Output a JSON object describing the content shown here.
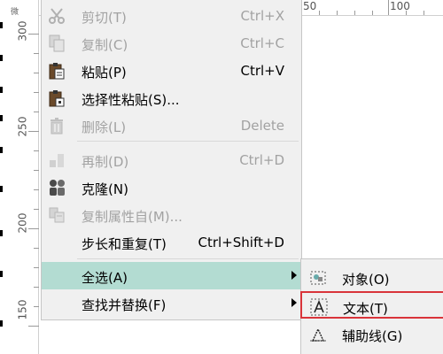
{
  "ruler": {
    "corner": "微",
    "vertical_labels": [
      "300",
      "250",
      "200",
      "150"
    ],
    "horizontal_labels": [
      "50",
      "100"
    ]
  },
  "menu": {
    "items": [
      {
        "label": "剪切(T)",
        "shortcut": "Ctrl+X",
        "icon": "scissors-icon",
        "enabled": false
      },
      {
        "label": "复制(C)",
        "shortcut": "Ctrl+C",
        "icon": "copy-icon",
        "enabled": false
      },
      {
        "label": "粘贴(P)",
        "shortcut": "Ctrl+V",
        "icon": "paste-icon",
        "enabled": true
      },
      {
        "label": "选择性粘贴(S)...",
        "shortcut": "",
        "icon": "paste-special-icon",
        "enabled": true
      },
      {
        "label": "删除(L)",
        "shortcut": "Delete",
        "icon": "trash-icon",
        "enabled": false
      },
      {
        "label": "再制(D)",
        "shortcut": "Ctrl+D",
        "icon": "duplicate-icon",
        "enabled": false
      },
      {
        "label": "克隆(N)",
        "shortcut": "",
        "icon": "clone-icon",
        "enabled": true
      },
      {
        "label": "复制属性自(M)...",
        "shortcut": "",
        "icon": "copy-properties-icon",
        "enabled": false
      },
      {
        "label": "步长和重复(T)",
        "shortcut": "Ctrl+Shift+D",
        "icon": "",
        "enabled": true
      },
      {
        "label": "全选(A)",
        "shortcut": "",
        "icon": "",
        "enabled": true,
        "submenu": true,
        "highlighted": true
      },
      {
        "label": "查找并替换(F)",
        "shortcut": "",
        "icon": "",
        "enabled": true,
        "submenu": true
      }
    ]
  },
  "submenu": {
    "items": [
      {
        "label": "对象(O)",
        "icon": "select-objects-icon"
      },
      {
        "label": "文本(T)",
        "icon": "select-text-icon",
        "highlighted_box": true
      },
      {
        "label": "辅助线(G)",
        "icon": "select-guidelines-icon"
      }
    ]
  },
  "colors": {
    "menu_bg": "#f0f0f0",
    "highlight": "#b3dcd2",
    "disabled_text": "#a2a2a2",
    "red_box": "#d9343a"
  }
}
